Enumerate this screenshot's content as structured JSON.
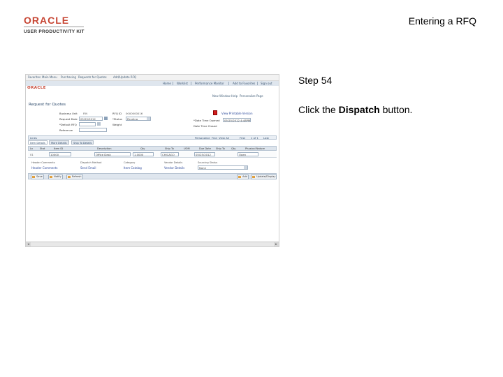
{
  "logo": {
    "brand": "ORACLE",
    "product": "USER PRODUCTIVITY KIT"
  },
  "header": {
    "title": "Entering a RFQ"
  },
  "step": {
    "label": "Step 54"
  },
  "instruction": {
    "prefix": "Click the ",
    "target": "Dispatch",
    "suffix": " button."
  },
  "screenshot": {
    "top_links": [
      "Favorites",
      "Main Menu",
      "Purchasing",
      "Requests for Quotes",
      "Add/Update RFQ"
    ],
    "nav": [
      "Home",
      "Worklist",
      "Performance Monitor",
      "Add to Favorites",
      "Sign out"
    ],
    "brand": "ORACLE",
    "page_links": [
      "New Window",
      "Help",
      "Personalize Page"
    ],
    "page_title": "Request for Quotes",
    "fields": {
      "business_unit_label": "Business Unit",
      "business_unit": "FIN",
      "rfq_id_label": "RFQ ID",
      "rfq_id": "0000000016",
      "request_date_label": "Request Date",
      "request_date": "05/25/2012",
      "status_label": "*Status",
      "status": "Pending",
      "due_date_label": "*Date Time Opened",
      "due_date": "05/25/2012 4:48PM",
      "rfq_type_label": "*Default RFQ",
      "weight_label": "Weight",
      "close_label": "Date Time Closed",
      "reference_label": "Reference",
      "dispatch_link": "View Printable Version"
    },
    "grid": {
      "title": "Lines",
      "nav": [
        "Personalize",
        "Find",
        "View All",
        "First",
        "1 of 1",
        "Last"
      ],
      "tabs": [
        "Item Details",
        "More Details",
        "Ship To Details"
      ],
      "columns": [
        "Ln",
        "Stat",
        "Item ID",
        "Description",
        "Qty",
        "Ship To",
        "UOM",
        "Due Date",
        "Ship To",
        "Qty",
        "Physical Nature"
      ],
      "row": {
        "ln": "01",
        "item": "10000",
        "desc": "Office Desk",
        "qty": "1.0000",
        "shipto": "CHICAGO",
        "due": "05/25/2012",
        "status": "Open"
      }
    },
    "links": [
      "Header Comments",
      "Send Email",
      "Item Catalog",
      "Vendor Details"
    ],
    "link_labels": [
      "Header Comments",
      "Dispatch Method",
      "Category",
      "Vendor Details"
    ],
    "status_bar_label": "Sourcing Status",
    "status_select": "None",
    "buttons": [
      "Save",
      "Notify",
      "Refresh",
      "Add",
      "Update/Display"
    ]
  }
}
